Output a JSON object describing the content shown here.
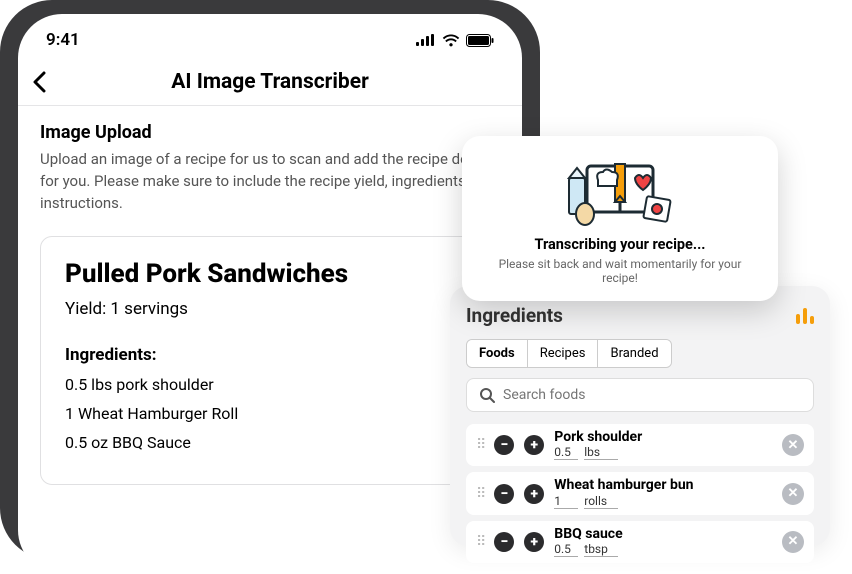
{
  "status": {
    "time": "9:41"
  },
  "nav": {
    "title": "AI Image Transcriber"
  },
  "upload": {
    "title": "Image Upload",
    "desc": "Upload an image of a recipe for us to scan and add the recipe details for you. Please make sure to include the recipe yield, ingredients, and instructions."
  },
  "recipe": {
    "title": "Pulled Pork Sandwiches",
    "yield": "Yield: 1 servings",
    "ingredients_heading": "Ingredients:",
    "lines": [
      "0.5 lbs pork shoulder",
      "1 Wheat Hamburger Roll",
      "0.5 oz BBQ Sauce"
    ]
  },
  "popover": {
    "title": "Transcribing your recipe...",
    "sub": "Please sit back and wait momentarily for your recipe!"
  },
  "panel": {
    "title": "Ingredients",
    "tabs": [
      "Foods",
      "Recipes",
      "Branded"
    ],
    "active_tab": 0,
    "search_placeholder": "Search foods",
    "rows": [
      {
        "name": "Pork shoulder",
        "amount": "0.5",
        "unit": "lbs"
      },
      {
        "name": "Wheat hamburger bun",
        "amount": "1",
        "unit": "rolls"
      },
      {
        "name": "BBQ sauce",
        "amount": "0.5",
        "unit": "tbsp"
      }
    ]
  }
}
